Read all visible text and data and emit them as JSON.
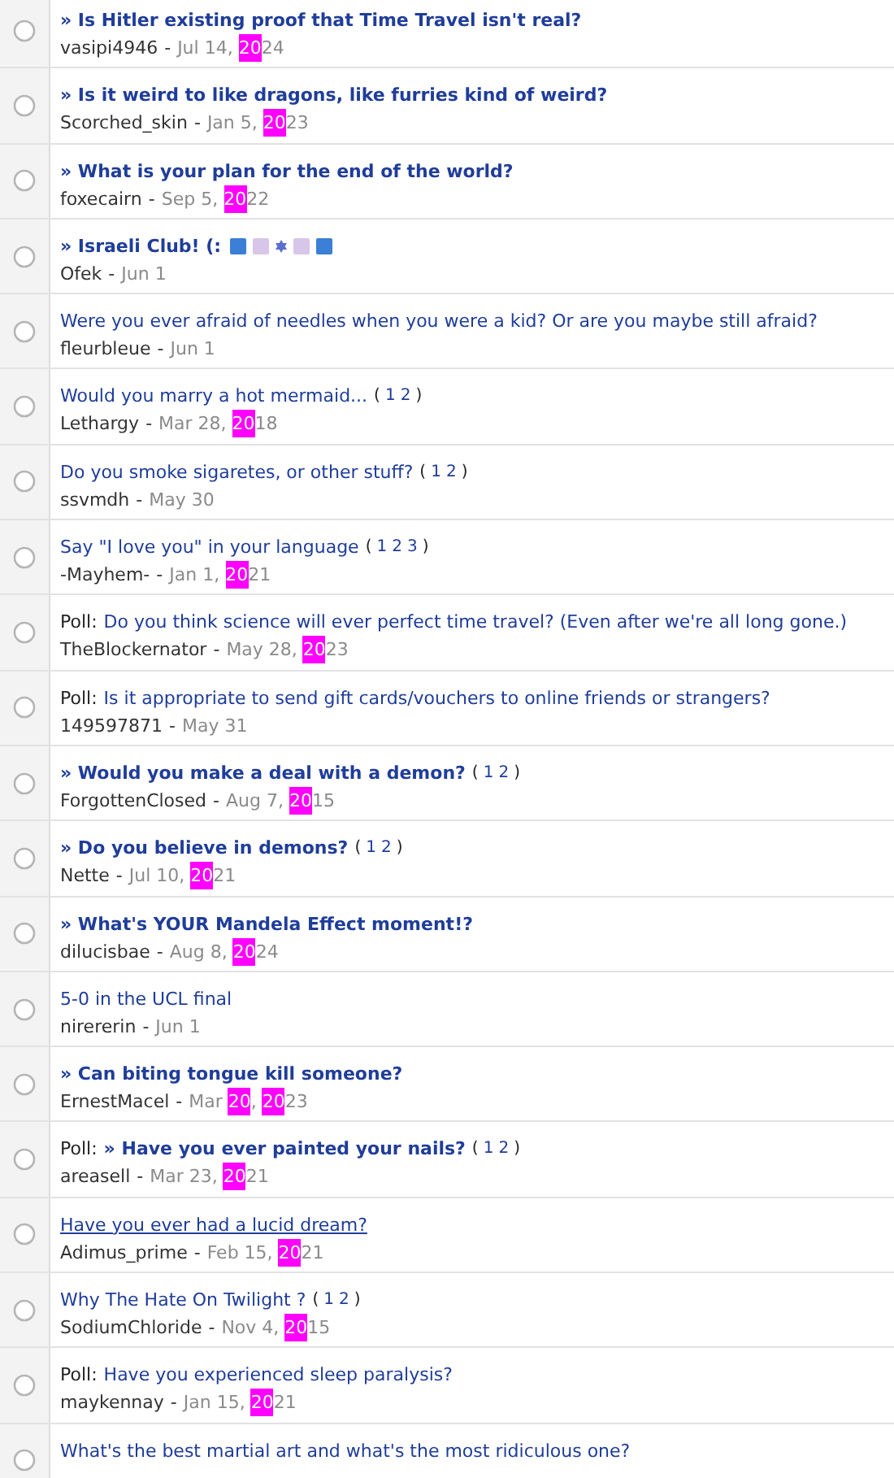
{
  "topics": [
    {
      "poll": false,
      "sticky": true,
      "hovered": false,
      "selected": false,
      "title": "» Is Hitler existing proof that Time Travel isn't real?",
      "author": "vasipi4946",
      "separator": "-",
      "date": [
        {
          "text": "Jul 14, ",
          "highlighted": false
        },
        {
          "text": "20",
          "highlighted": true
        },
        {
          "text": "24",
          "highlighted": false
        }
      ]
    },
    {
      "poll": false,
      "sticky": true,
      "hovered": false,
      "selected": false,
      "title": "» Is it weird to like dragons, like furries kind of weird?",
      "author": "Scorched_skin",
      "separator": "-",
      "date": [
        {
          "text": "Jan 5, ",
          "highlighted": false
        },
        {
          "text": "20",
          "highlighted": true
        },
        {
          "text": "23",
          "highlighted": false
        }
      ]
    },
    {
      "poll": false,
      "sticky": true,
      "hovered": false,
      "selected": false,
      "title": "» What is your plan for the end of the world?",
      "author": "foxecairn",
      "separator": "-",
      "date": [
        {
          "text": "Sep 5, ",
          "highlighted": false
        },
        {
          "text": "20",
          "highlighted": true
        },
        {
          "text": "22",
          "highlighted": false
        }
      ]
    },
    {
      "poll": false,
      "sticky": true,
      "hovered": false,
      "selected": false,
      "separator": "-",
      "title": "» Israeli Club! (:",
      "marks": [
        {
          "kind": "square",
          "color": "#3b7fd6"
        },
        {
          "kind": "square",
          "color": "#d8c6ea"
        },
        {
          "kind": "star",
          "color": "#5b6fd0"
        },
        {
          "kind": "square",
          "color": "#d8c6ea"
        },
        {
          "kind": "square",
          "color": "#3b7fd6"
        }
      ],
      "author": "Ofek",
      "date": [
        {
          "text": "Jun 1",
          "highlighted": false
        }
      ]
    },
    {
      "poll": false,
      "sticky": false,
      "hovered": false,
      "selected": false,
      "separator": "-",
      "title": "Were you ever afraid of needles when you were a kid? Or are you maybe still afraid?",
      "author": "fleurbleue",
      "date": [
        {
          "text": "Jun 1",
          "highlighted": false
        }
      ]
    },
    {
      "poll": false,
      "sticky": false,
      "hovered": false,
      "selected": false,
      "separator": "-",
      "title": "Would you marry a hot mermaid...",
      "pages": {
        "open": "(",
        "links": [
          "1",
          "2"
        ],
        "close": ")"
      },
      "author": "Lethargy",
      "date": [
        {
          "text": "Mar 28, ",
          "highlighted": false
        },
        {
          "text": "20",
          "highlighted": true
        },
        {
          "text": "18",
          "highlighted": false
        }
      ]
    },
    {
      "poll": false,
      "sticky": false,
      "hovered": false,
      "selected": false,
      "separator": "-",
      "title": "Do you smoke sigaretes, or other stuff?",
      "pages": {
        "open": "(",
        "links": [
          "1",
          "2"
        ],
        "close": ")"
      },
      "author": "ssvmdh",
      "date": [
        {
          "text": "May 30",
          "highlighted": false
        }
      ]
    },
    {
      "poll": false,
      "sticky": false,
      "hovered": false,
      "selected": false,
      "separator": "-",
      "title": "Say \"I love you\" in your language",
      "pages": {
        "open": "(",
        "links": [
          "1",
          "2",
          "3"
        ],
        "close": ")"
      },
      "author": "-Mayhem-",
      "date": [
        {
          "text": "Jan 1, ",
          "highlighted": false
        },
        {
          "text": "20",
          "highlighted": true
        },
        {
          "text": "21",
          "highlighted": false
        }
      ]
    },
    {
      "poll": true,
      "poll_label": "Poll:",
      "sticky": false,
      "hovered": false,
      "selected": false,
      "separator": "-",
      "title": "Do you think science will ever perfect time travel? (Even after we're all long gone.)",
      "author": "TheBlockernator",
      "date": [
        {
          "text": "May 28, ",
          "highlighted": false
        },
        {
          "text": "20",
          "highlighted": true
        },
        {
          "text": "23",
          "highlighted": false
        }
      ]
    },
    {
      "poll": true,
      "poll_label": "Poll:",
      "sticky": false,
      "hovered": false,
      "selected": false,
      "separator": "-",
      "title": "Is it appropriate to send gift cards/vouchers to online friends or strangers?",
      "author": "149597871",
      "date": [
        {
          "text": "May 31",
          "highlighted": false
        }
      ]
    },
    {
      "poll": false,
      "sticky": true,
      "hovered": false,
      "selected": false,
      "separator": "-",
      "title": "» Would you make a deal with a demon?",
      "pages": {
        "open": "(",
        "links": [
          "1",
          "2"
        ],
        "close": ")"
      },
      "author": "ForgottenClosed",
      "date": [
        {
          "text": "Aug 7, ",
          "highlighted": false
        },
        {
          "text": "20",
          "highlighted": true
        },
        {
          "text": "15",
          "highlighted": false
        }
      ]
    },
    {
      "poll": false,
      "sticky": true,
      "hovered": false,
      "selected": false,
      "separator": "-",
      "title": "» Do you believe in demons?",
      "pages": {
        "open": "(",
        "links": [
          "1",
          "2"
        ],
        "close": ")"
      },
      "author": "Nette",
      "date": [
        {
          "text": "Jul 10, ",
          "highlighted": false
        },
        {
          "text": "20",
          "highlighted": true
        },
        {
          "text": "21",
          "highlighted": false
        }
      ]
    },
    {
      "poll": false,
      "sticky": true,
      "hovered": false,
      "selected": false,
      "separator": "-",
      "title": "» What's YOUR Mandela Effect moment!?",
      "author": "dilucisbae",
      "date": [
        {
          "text": "Aug 8, ",
          "highlighted": false
        },
        {
          "text": "20",
          "highlighted": true
        },
        {
          "text": "24",
          "highlighted": false
        }
      ]
    },
    {
      "poll": false,
      "sticky": false,
      "hovered": false,
      "selected": false,
      "separator": "-",
      "title": "5-0 in the UCL final",
      "author": "nirererin",
      "date": [
        {
          "text": "Jun 1",
          "highlighted": false
        }
      ]
    },
    {
      "poll": false,
      "sticky": true,
      "hovered": false,
      "selected": false,
      "separator": "-",
      "title": "» Can biting tongue kill someone?",
      "author": "ErnestMacel",
      "date": [
        {
          "text": "Mar ",
          "highlighted": false
        },
        {
          "text": "20",
          "highlighted": true
        },
        {
          "text": ", ",
          "highlighted": false
        },
        {
          "text": "20",
          "highlighted": true
        },
        {
          "text": "23",
          "highlighted": false
        }
      ]
    },
    {
      "poll": true,
      "poll_label": "Poll:",
      "sticky": true,
      "hovered": false,
      "selected": false,
      "separator": "-",
      "title": "» Have you ever painted your nails?",
      "pages": {
        "open": "(",
        "links": [
          "1",
          "2"
        ],
        "close": ")"
      },
      "author": "areasell",
      "date": [
        {
          "text": "Mar 23, ",
          "highlighted": false
        },
        {
          "text": "20",
          "highlighted": true
        },
        {
          "text": "21",
          "highlighted": false
        }
      ]
    },
    {
      "poll": false,
      "sticky": false,
      "hovered": true,
      "selected": false,
      "separator": "-",
      "title": "Have you ever had a lucid dream?",
      "author": "Adimus_prime",
      "date": [
        {
          "text": "Feb 15, ",
          "highlighted": false
        },
        {
          "text": "20",
          "highlighted": true
        },
        {
          "text": "21",
          "highlighted": false
        }
      ]
    },
    {
      "poll": false,
      "sticky": false,
      "hovered": false,
      "selected": false,
      "separator": "-",
      "title": "Why The Hate On Twilight ?",
      "pages": {
        "open": "(",
        "links": [
          "1",
          "2"
        ],
        "close": ")"
      },
      "author": "SodiumChloride",
      "date": [
        {
          "text": "Nov 4, ",
          "highlighted": false
        },
        {
          "text": "20",
          "highlighted": true
        },
        {
          "text": "15",
          "highlighted": false
        }
      ]
    },
    {
      "poll": true,
      "poll_label": "Poll:",
      "sticky": false,
      "hovered": false,
      "selected": false,
      "separator": "-",
      "title": "Have you experienced sleep paralysis?",
      "author": "maykennay",
      "date": [
        {
          "text": "Jan 15, ",
          "highlighted": false
        },
        {
          "text": "20",
          "highlighted": true
        },
        {
          "text": "21",
          "highlighted": false
        }
      ]
    },
    {
      "poll": false,
      "sticky": false,
      "hovered": false,
      "selected": false,
      "title": "What's the best martial art and what's the most ridiculous one?"
    }
  ]
}
